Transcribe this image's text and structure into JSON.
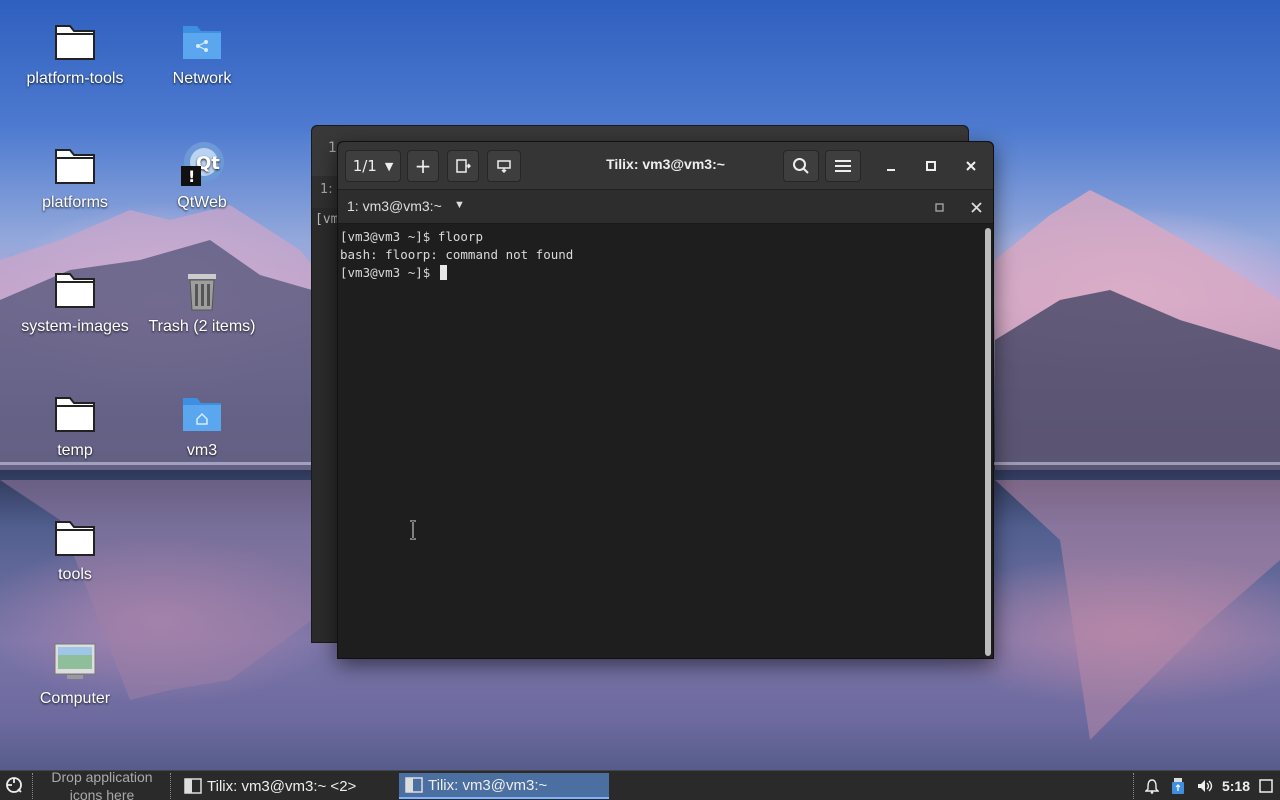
{
  "desktop": {
    "icons": [
      {
        "label": "platform-tools",
        "icon": "folder-icon"
      },
      {
        "label": "Network",
        "icon": "network-folder-icon"
      },
      {
        "label": "platforms",
        "icon": "folder-icon"
      },
      {
        "label": "QtWeb",
        "icon": "qtweb-icon"
      },
      {
        "label": "system-images",
        "icon": "folder-icon"
      },
      {
        "label": "Trash (2 items)",
        "icon": "trash-icon"
      },
      {
        "label": "temp",
        "icon": "folder-icon"
      },
      {
        "label": "vm3",
        "icon": "home-folder-icon"
      },
      {
        "label": "tools",
        "icon": "folder-icon"
      },
      {
        "label": "Computer",
        "icon": "computer-icon"
      }
    ]
  },
  "back_window": {
    "tab_text": "1:",
    "prompt_fragment": "[vm",
    "header_fragment": "1"
  },
  "terminal_window": {
    "session_selector": "1/1",
    "title": "Tilix: vm3@vm3:~",
    "tab_label": "1: vm3@vm3:~",
    "lines": [
      "[vm3@vm3 ~]$ floorp",
      "bash: floorp: command not found",
      "[vm3@vm3 ~]$ "
    ]
  },
  "taskbar": {
    "launcher_hint": "Drop application icons here",
    "tasks": [
      {
        "label": "Tilix: vm3@vm3:~ <2>",
        "active": false
      },
      {
        "label": "Tilix: vm3@vm3:~",
        "active": true
      }
    ],
    "clock": "5:18"
  },
  "colors": {
    "accent": "#4a6fa0",
    "terminal_bg": "#1e1e1e",
    "headerbar": "#353535"
  }
}
